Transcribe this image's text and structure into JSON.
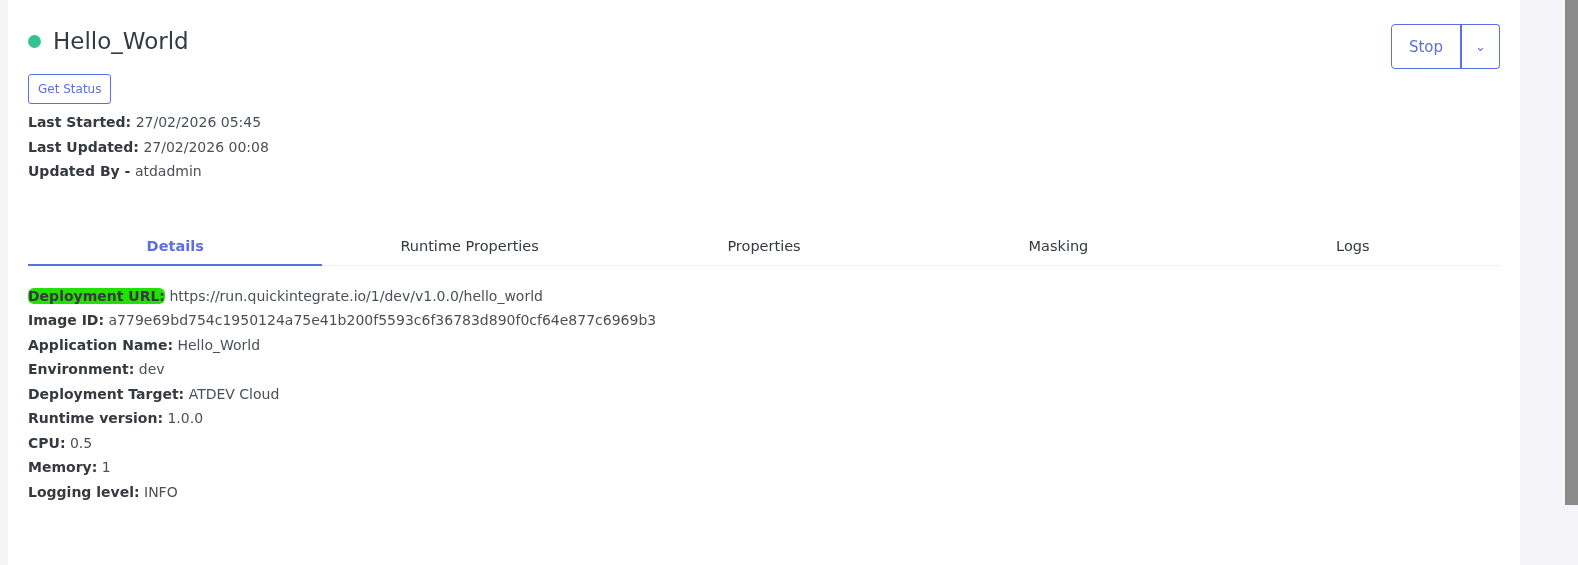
{
  "app": {
    "name": "Hello_World",
    "dot": {
      "color": "#34c38f"
    }
  },
  "get_status_button": "Get Status",
  "stop_button": {
    "label": "Stop",
    "caret": "⌄"
  },
  "meta": [
    "**Last Started:** 27/02/2026 05:45",
    "**Last Updated:** 27/02/2026 00:08",
    "**Updated By -** atdadmin"
  ],
  "tabs": [
    {
      "label": "Details",
      "selected": true
    },
    {
      "label": "Runtime Properties",
      "selected": false
    },
    {
      "label": "Properties",
      "selected": false
    },
    {
      "label": "Masking",
      "selected": false
    },
    {
      "label": "Logs",
      "selected": false
    }
  ],
  "details": [
    {
      "label": "Deployment URL:",
      "value": "https://run.quickintegrate.io/1/dev/v1.0.0/hello_world",
      "highlighted": true
    },
    {
      "label": "Image ID:",
      "value": "a779e69bd754c1950124a75e41b200f5593c6f36783d890f0cf64e877c6969b3",
      "highlighted": false
    },
    {
      "label": "Application Name:",
      "value": "Hello_World",
      "highlighted": false
    },
    {
      "label": "Environment:",
      "value": "dev",
      "highlighted": false
    },
    {
      "label": "Deployment Target:",
      "value": "ATDEV Cloud",
      "highlighted": false
    },
    {
      "label": "Runtime version:",
      "value": "1.0.0",
      "highlighted": false
    },
    {
      "label": "CPU:",
      "value": "0.5",
      "highlighted": false
    },
    {
      "label": "Memory:",
      "value": "1",
      "highlighted": false
    },
    {
      "label": "Logging level:",
      "value": "INFO",
      "highlighted": false
    }
  ]
}
